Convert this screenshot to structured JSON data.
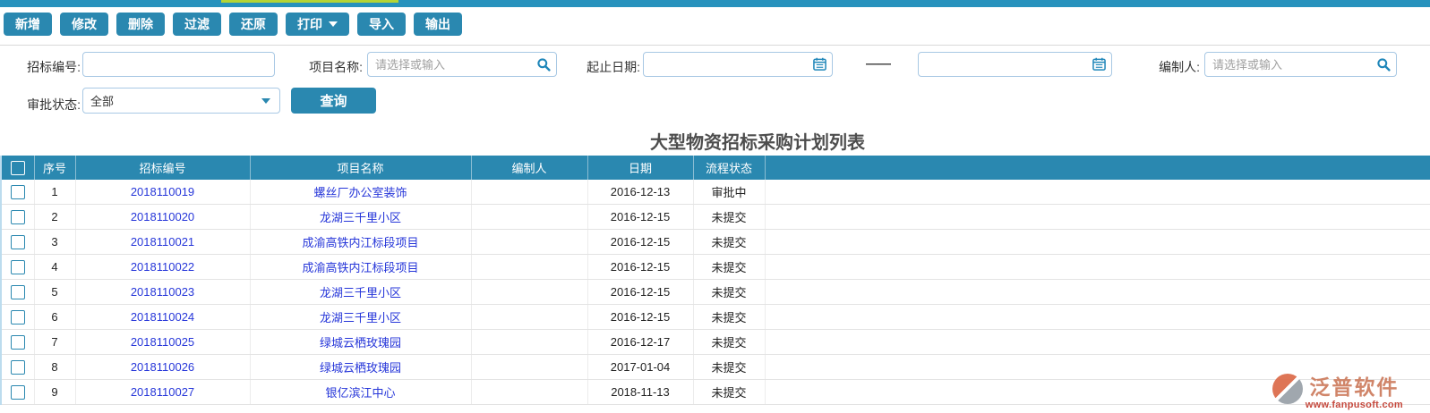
{
  "colors": {
    "teal": "#2a88b0",
    "teal_light": "#2792bd",
    "green": "#b5d435",
    "link": "#2636d9",
    "input_border": "#a8c8e4"
  },
  "toolbar": {
    "buttons": [
      {
        "name": "add",
        "label": "新增"
      },
      {
        "name": "modify",
        "label": "修改"
      },
      {
        "name": "delete",
        "label": "删除"
      },
      {
        "name": "filter",
        "label": "过滤"
      },
      {
        "name": "restore",
        "label": "还原"
      },
      {
        "name": "print",
        "label": "打印",
        "has_dropdown": true
      },
      {
        "name": "import",
        "label": "导入"
      },
      {
        "name": "export",
        "label": "输出"
      }
    ]
  },
  "filters": {
    "bid_no_label": "招标编号:",
    "bid_no_value": "",
    "project_label": "项目名称:",
    "project_placeholder": "请选择或输入",
    "date_range_label": "起止日期:",
    "date_start_value": "",
    "date_end_value": "",
    "range_separator": "——",
    "compiler_label": "编制人:",
    "compiler_placeholder": "请选择或输入",
    "approval_label": "审批状态:",
    "approval_value": "全部",
    "query_button": "查询"
  },
  "page_title": "大型物资招标采购计划列表",
  "table": {
    "headers": [
      "序号",
      "招标编号",
      "项目名称",
      "编制人",
      "日期",
      "流程状态"
    ],
    "rows": [
      {
        "seq": "1",
        "bid_no": "2018110019",
        "project": "螺丝厂办公室装饰",
        "compiler": "",
        "date": "2016-12-13",
        "status": "审批中"
      },
      {
        "seq": "2",
        "bid_no": "2018110020",
        "project": "龙湖三千里小区",
        "compiler": "",
        "date": "2016-12-15",
        "status": "未提交"
      },
      {
        "seq": "3",
        "bid_no": "2018110021",
        "project": "成渝高铁内江标段项目",
        "compiler": "",
        "date": "2016-12-15",
        "status": "未提交"
      },
      {
        "seq": "4",
        "bid_no": "2018110022",
        "project": "成渝高铁内江标段项目",
        "compiler": "",
        "date": "2016-12-15",
        "status": "未提交"
      },
      {
        "seq": "5",
        "bid_no": "2018110023",
        "project": "龙湖三千里小区",
        "compiler": "",
        "date": "2016-12-15",
        "status": "未提交"
      },
      {
        "seq": "6",
        "bid_no": "2018110024",
        "project": "龙湖三千里小区",
        "compiler": "",
        "date": "2016-12-15",
        "status": "未提交"
      },
      {
        "seq": "7",
        "bid_no": "2018110025",
        "project": "绿城云栖玫瑰园",
        "compiler": "",
        "date": "2016-12-17",
        "status": "未提交"
      },
      {
        "seq": "8",
        "bid_no": "2018110026",
        "project": "绿城云栖玫瑰园",
        "compiler": "",
        "date": "2017-01-04",
        "status": "未提交"
      },
      {
        "seq": "9",
        "bid_no": "2018110027",
        "project": "银亿滨江中心",
        "compiler": "",
        "date": "2018-11-13",
        "status": "未提交"
      }
    ]
  },
  "watermark": {
    "brand": "泛普软件",
    "website": "www.fanpusoft.com"
  }
}
